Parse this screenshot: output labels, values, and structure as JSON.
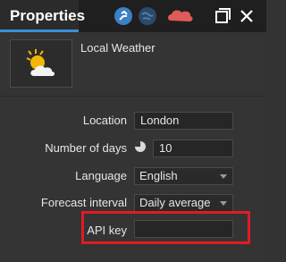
{
  "titlebar": {
    "tab_label": "Properties",
    "icons": [
      "share-icon",
      "globe-icon",
      "cloud-icon",
      "maximize-icon",
      "close-icon"
    ]
  },
  "header": {
    "title": "Local Weather",
    "thumbnail_icon": "partly-sunny-icon"
  },
  "form": {
    "location": {
      "label": "Location",
      "value": "London"
    },
    "days": {
      "label": "Number of days",
      "value": "10",
      "icon": "pie-chart-icon"
    },
    "language": {
      "label": "Language",
      "value": "English"
    },
    "interval": {
      "label": "Forecast interval",
      "value": "Daily average"
    },
    "api_key": {
      "label": "API key",
      "value": ""
    }
  },
  "colors": {
    "accent": "#3a8fd6",
    "highlight": "#e01b24",
    "background": "#343434"
  }
}
